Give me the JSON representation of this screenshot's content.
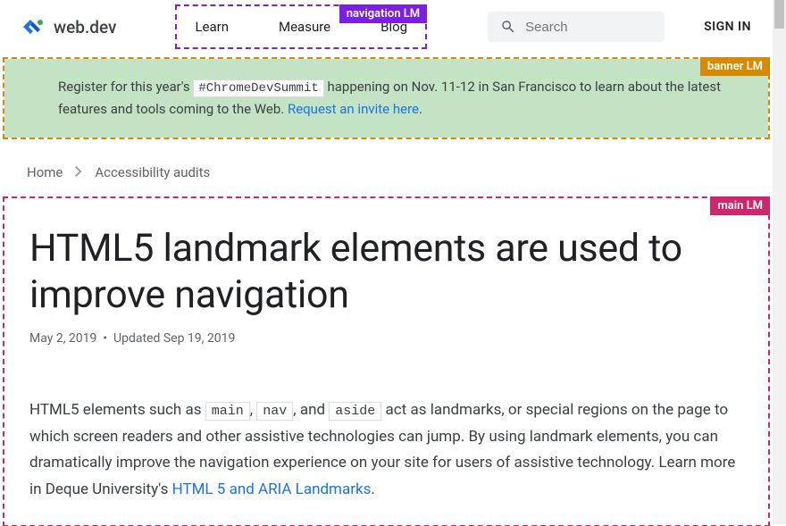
{
  "header": {
    "site_name": "web.dev",
    "nav": [
      "Learn",
      "Measure",
      "Blog"
    ],
    "nav_lm_tag": "navigation LM",
    "search_placeholder": "Search",
    "signin": "SIGN IN"
  },
  "banner": {
    "lm_tag": "banner LM",
    "text_before": "Register for this year's ",
    "hashtag": "#ChromeDevSummit",
    "text_mid": " happening on Nov. 11-12 in San Francisco to learn about the latest features and tools coming to the Web. ",
    "link": "Request an invite here",
    "text_after": "."
  },
  "breadcrumbs": {
    "home": "Home",
    "current": "Accessibility audits"
  },
  "main": {
    "lm_tag": "main LM",
    "title": "HTML5 landmark elements are used to improve navigation",
    "date_published": "May 2, 2019",
    "date_updated": "Updated Sep 19, 2019",
    "para1_a": "HTML5 elements such as ",
    "code1": "main",
    "para1_b": ", ",
    "code2": "nav",
    "para1_c": ", and ",
    "code3": "aside",
    "para1_d": " act as landmarks, or special regions on the page to which screen readers and other assistive technologies can jump. By using landmark elements, you can dramatically improve the navigation experience on your site for users of assistive technology. Learn more in Deque University's ",
    "link1": "HTML 5 and ARIA Landmarks",
    "para1_e": "."
  }
}
